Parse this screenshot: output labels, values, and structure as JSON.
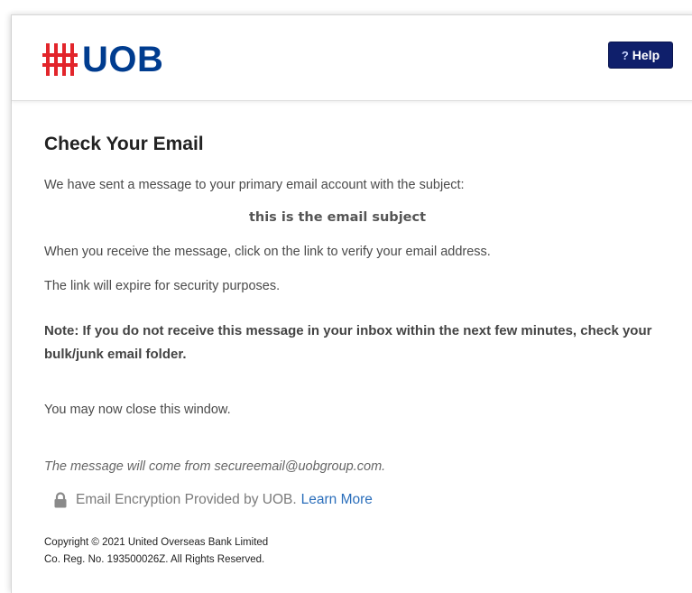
{
  "header": {
    "brand": "UOB",
    "help_label": "Help",
    "help_icon": "question-mark-icon",
    "brand_colors": {
      "logo_red": "#e2252b",
      "logo_blue": "#003c8f",
      "help_bg": "#0f1f6b"
    }
  },
  "main": {
    "title": "Check Your Email",
    "intro": "We have sent a message to your primary email account with the subject:",
    "subject": "this is the email subject",
    "instruction": "When you receive the message, click on the link to verify your email address.",
    "expiry": "The link will expire for security purposes.",
    "note": "Note: If you do not receive this message in your inbox within the next few minutes, check your bulk/junk email folder.",
    "close": "You may now close this window.",
    "sender_note": "The message will come from secureemail@uobgroup.com.",
    "encryption_text": "Email Encryption Provided by UOB.",
    "learn_more": "Learn More",
    "encryption_icon": "lock-icon"
  },
  "footer": {
    "copyright": "Copyright © 2021 United Overseas Bank Limited",
    "reg": "Co. Reg. No. 193500026Z. All Rights Reserved."
  }
}
